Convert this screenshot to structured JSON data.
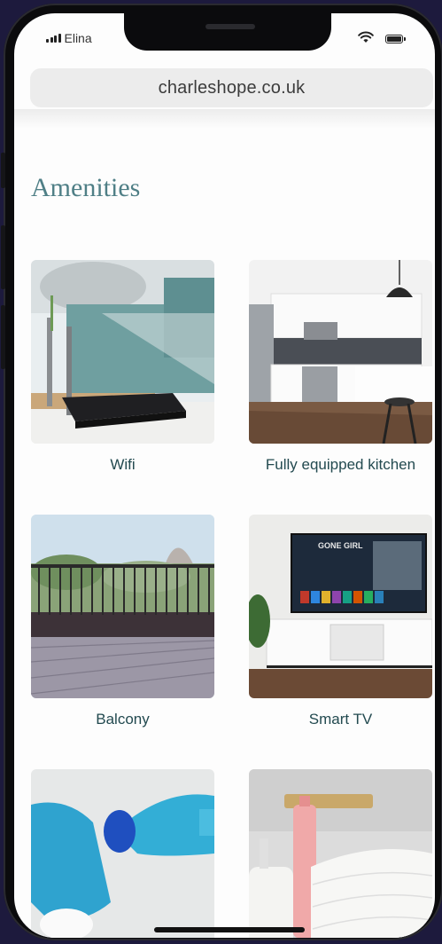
{
  "status_bar": {
    "carrier": "Elina"
  },
  "browser": {
    "url": "charleshope.co.uk"
  },
  "page": {
    "heading": "Amenities",
    "amenities": [
      {
        "label": "Wifi",
        "image": "wifi-router-photo"
      },
      {
        "label": "Fully equipped kitchen",
        "image": "kitchen-photo"
      },
      {
        "label": "Balcony",
        "image": "balcony-photo"
      },
      {
        "label": "Smart TV",
        "image": "smart-tv-photo"
      },
      {
        "label": "",
        "image": "cleaning-photo"
      },
      {
        "label": "",
        "image": "toiletries-towels-photo"
      }
    ],
    "tv_screen_text": "GONE GIRL"
  }
}
